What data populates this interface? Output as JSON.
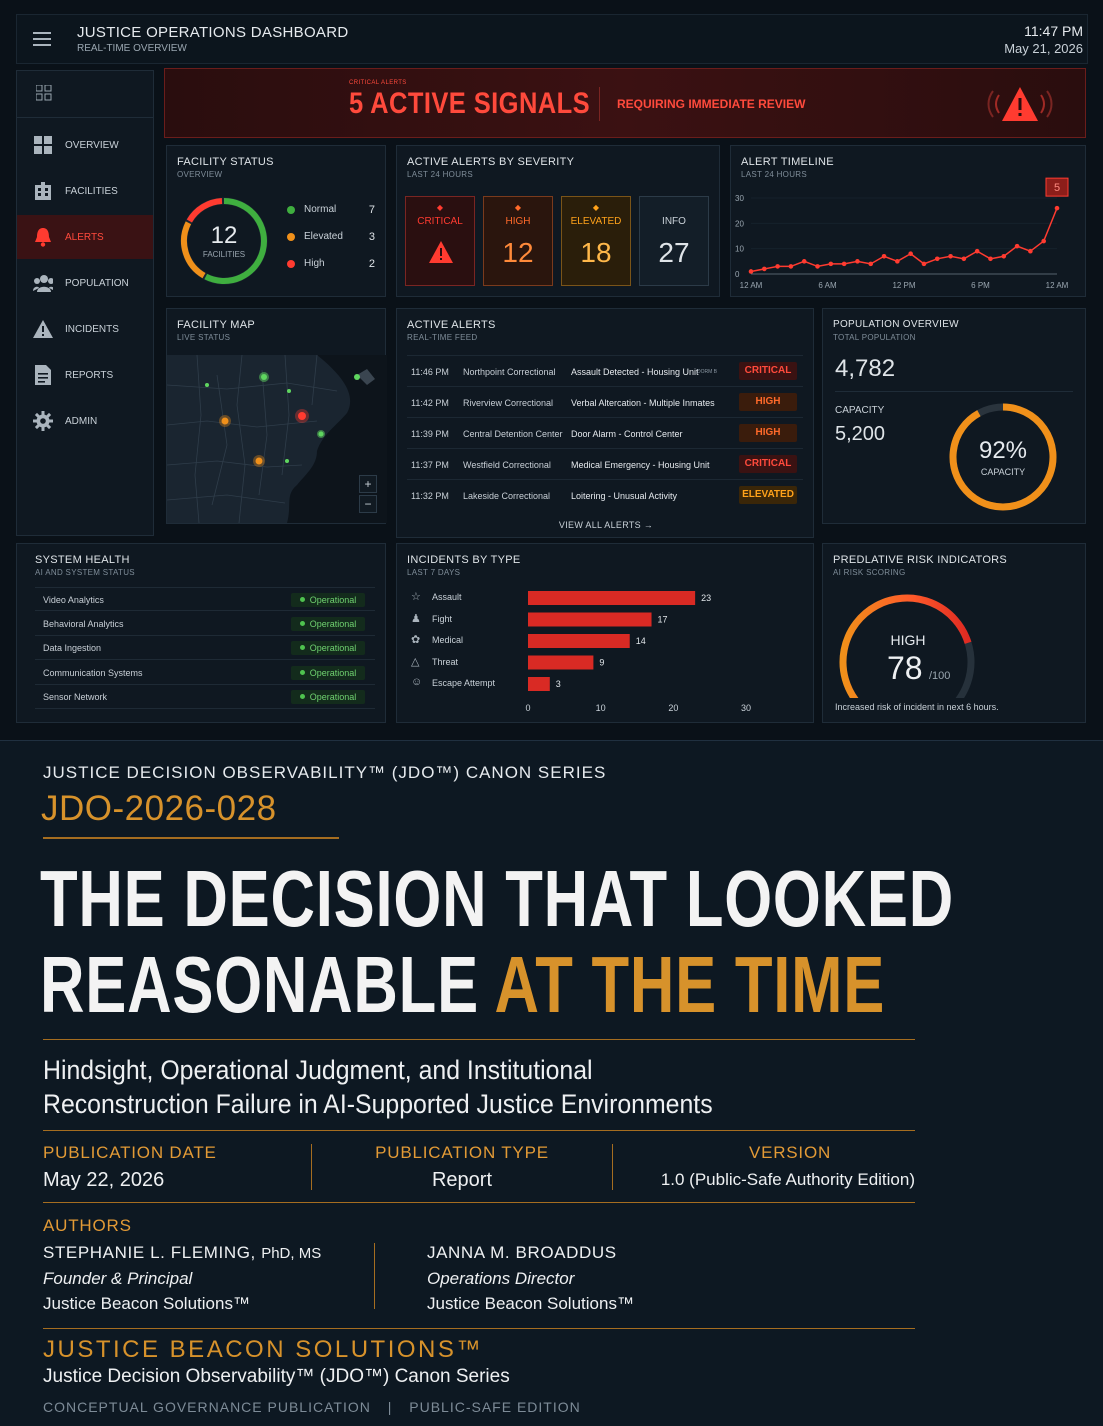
{
  "header": {
    "title": "JUSTICE OPERATIONS DASHBOARD",
    "subtitle": "REAL-TIME OVERVIEW",
    "time": "11:47 PM",
    "date": "May 21, 2026"
  },
  "sidebar": {
    "items": [
      {
        "label": "OVERVIEW",
        "icon": "grid-icon"
      },
      {
        "label": "FACILITIES",
        "icon": "building-icon"
      },
      {
        "label": "ALERTS",
        "icon": "bell-icon",
        "active": true
      },
      {
        "label": "POPULATION",
        "icon": "people-icon"
      },
      {
        "label": "INCIDENTS",
        "icon": "warning-icon"
      },
      {
        "label": "REPORTS",
        "icon": "document-icon"
      },
      {
        "label": "ADMIN",
        "icon": "gear-icon"
      }
    ]
  },
  "banner": {
    "kicker": "CRITICAL ALERTS",
    "headline": "5 ACTIVE SIGNALS",
    "note": "REQUIRING IMMEDIATE REVIEW"
  },
  "facility_status": {
    "title": "FACILITY STATUS",
    "subtitle": "OVERVIEW",
    "total": "12",
    "total_label": "FACILITIES",
    "legend": [
      {
        "label": "Normal",
        "value": "7",
        "color": "#3fae3f"
      },
      {
        "label": "Elevated",
        "value": "3",
        "color": "#f0901a"
      },
      {
        "label": "High",
        "value": "2",
        "color": "#ff3b30"
      }
    ]
  },
  "severity": {
    "title": "ACTIVE ALERTS BY SEVERITY",
    "subtitle": "LAST 24 HOURS",
    "boxes": [
      {
        "label": "CRITICAL",
        "value": "",
        "color": "#ff3b30"
      },
      {
        "label": "HIGH",
        "value": "12",
        "color": "#ff6a2a"
      },
      {
        "label": "ELEVATED",
        "value": "18",
        "color": "#ffa21a"
      },
      {
        "label": "INFO",
        "value": "27",
        "color": "#c9d1d8"
      }
    ]
  },
  "timeline": {
    "title": "ALERT TIMELINE",
    "subtitle": "LAST 24 HOURS",
    "callout": "5"
  },
  "chart_data": [
    {
      "type": "line",
      "x": [
        "12 AM",
        "",
        "",
        "",
        "",
        "",
        "",
        "",
        "",
        "",
        "",
        "",
        "",
        "",
        "",
        "",
        "",
        "",
        "",
        "",
        "12 AM"
      ],
      "y": [
        1,
        2,
        3,
        3,
        5,
        3,
        4,
        4,
        5,
        4,
        7,
        5,
        8,
        4,
        6,
        7,
        6,
        9,
        6,
        7,
        11,
        9,
        13,
        26
      ],
      "xticks": [
        "12 AM",
        "6 AM",
        "12 PM",
        "6 PM",
        "12 AM"
      ],
      "yticks": [
        "0",
        "10",
        "20",
        "30"
      ],
      "ylim": [
        0,
        30
      ],
      "callout": "5"
    },
    {
      "type": "bar",
      "orientation": "horizontal",
      "title": "INCIDENTS BY TYPE",
      "subtitle": "LAST 7 DAYS",
      "categories": [
        "Assault",
        "Fight",
        "Medical",
        "Threat",
        "Escape Attempt"
      ],
      "values": [
        23,
        17,
        14,
        9,
        3
      ],
      "xticks": [
        "0",
        "10",
        "20",
        "30"
      ],
      "xlim": [
        0,
        30
      ]
    },
    {
      "type": "pie",
      "title": "FACILITY STATUS",
      "categories": [
        "Normal",
        "Elevated",
        "High"
      ],
      "values": [
        7,
        3,
        2
      ]
    }
  ],
  "map": {
    "title": "FACILITY MAP",
    "subtitle": "LIVE STATUS",
    "zoom_in": "+",
    "zoom_out": "−"
  },
  "active_alerts": {
    "title": "ACTIVE ALERTS",
    "subtitle": "REAL-TIME FEED",
    "view_all": "VIEW ALL ALERTS →",
    "rows": [
      {
        "time": "11:46 PM",
        "facility": "Northpoint Correctional",
        "event": "Assault Detected - Housing Unit",
        "tag": "DORM B",
        "level": "CRITICAL"
      },
      {
        "time": "11:42 PM",
        "facility": "Riverview Correctional",
        "event": "Verbal Altercation - Multiple Inmates",
        "tag": "",
        "level": "HIGH"
      },
      {
        "time": "11:39 PM",
        "facility": "Central Detention Center",
        "event": "Door Alarm - Control Center",
        "tag": "",
        "level": "HIGH"
      },
      {
        "time": "11:37 PM",
        "facility": "Westfield Correctional",
        "event": "Medical Emergency - Housing Unit",
        "tag": "",
        "level": "CRITICAL"
      },
      {
        "time": "11:32 PM",
        "facility": "Lakeside Correctional",
        "event": "Loitering - Unusual Activity",
        "tag": "",
        "level": "ELEVATED"
      }
    ]
  },
  "population": {
    "title": "POPULATION OVERVIEW",
    "subtitle": "TOTAL POPULATION",
    "total": "4,782",
    "capacity_label": "CAPACITY",
    "capacity": "5,200",
    "percent": "92%",
    "percent_label": "CAPACITY",
    "fraction": 0.92
  },
  "system_health": {
    "title": "SYSTEM HEALTH",
    "subtitle": "AI AND SYSTEM STATUS",
    "rows": [
      {
        "name": "Video Analytics",
        "status": "Operational"
      },
      {
        "name": "Behavioral Analytics",
        "status": "Operational"
      },
      {
        "name": "Data Ingestion",
        "status": "Operational"
      },
      {
        "name": "Communication Systems",
        "status": "Operational"
      },
      {
        "name": "Sensor Network",
        "status": "Operational"
      }
    ]
  },
  "risk": {
    "title": "PREDLATIVE RISK INDICATORS",
    "subtitle": "AI RISK SCORING",
    "level": "HIGH",
    "score": "78",
    "max": "/100",
    "score_fraction": 0.78,
    "note": "Increased risk of incident in next 6 hours."
  },
  "cover": {
    "series": "JUSTICE DECISION OBSERVABILITY™ (JDO™) CANON SERIES",
    "code": "JDO-2026-028",
    "title_line1": "THE DECISION THAT LOOKED",
    "title_line2a": "REASONABLE",
    "title_line2b": "AT THE TIME",
    "subtitle_line1": "Hindsight, Operational Judgment, and Institutional",
    "subtitle_line2": "Reconstruction Failure in AI-Supported Justice Environments",
    "meta": [
      {
        "label": "PUBLICATION DATE",
        "value": "May 22, 2026"
      },
      {
        "label": "PUBLICATION TYPE",
        "value": "Report"
      },
      {
        "label": "VERSION",
        "value": "1.0 (Public-Safe Authority Edition)"
      }
    ],
    "authors_label": "AUTHORS",
    "authors": [
      {
        "name": "STEPHANIE L. FLEMING,",
        "cred": "PhD, MS",
        "role": "Founder & Principal",
        "org": "Justice Beacon Solutions™"
      },
      {
        "name": "JANNA M. BROADDUS",
        "cred": "",
        "role": "Operations Director",
        "org": "Justice Beacon Solutions™"
      }
    ],
    "brand": "JUSTICE BEACON SOLUTIONS™",
    "brand_series": "Justice Decision Observability™ (JDO™) Canon Series",
    "footer_a": "CONCEPTUAL GOVERNANCE PUBLICATION",
    "footer_sep": "|",
    "footer_b": "PUBLIC-SAFE EDITION"
  },
  "colors": {
    "critical": "#ff3b30",
    "high": "#ff6a2a",
    "elevated": "#ffa21a",
    "normal": "#3fae3f",
    "gold": "#d7922b"
  }
}
